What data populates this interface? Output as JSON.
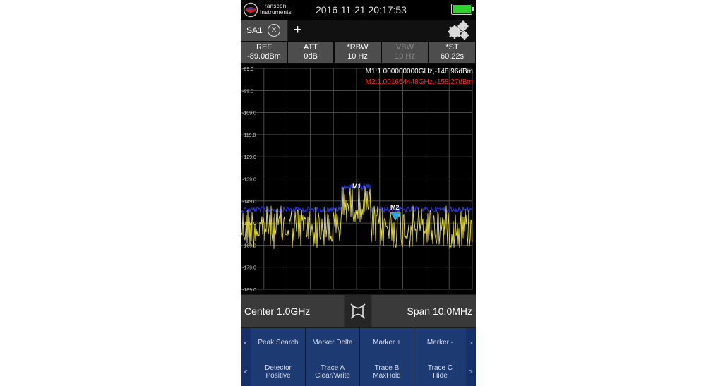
{
  "status_bar": {
    "brand_line1": "Transcon",
    "brand_line2": "Instruments",
    "datetime": "2016-11-21 20:17:53"
  },
  "tabs": {
    "active_label": "SA1",
    "close_glyph": "X",
    "add_glyph": "+"
  },
  "params": [
    {
      "label": "REF",
      "value": "-89.0dBm",
      "enabled": true
    },
    {
      "label": "ATT",
      "value": "0dB",
      "enabled": true
    },
    {
      "label": "*RBW",
      "value": "10 Hz",
      "enabled": true
    },
    {
      "label": "VBW",
      "value": "10 Hz",
      "enabled": false
    },
    {
      "label": "*ST",
      "value": "60.22s",
      "enabled": true
    }
  ],
  "plot": {
    "y_labels": [
      "-89.0",
      "-99.0",
      "-109.0",
      "-119.0",
      "-129.0",
      "-139.0",
      "-149.0",
      "-159.0",
      "-169.0",
      "-179.0",
      "-189.0"
    ],
    "marker1_readout": "M1:1.000000000GHz,-148.96dBm",
    "marker2_readout": "M2:1.001654448GHz,-158.27dBm",
    "marker1_label": "M1",
    "marker2_label": "M2",
    "colors": {
      "trace_a": "#e8e02a",
      "trace_b": "#2833d8",
      "marker1": "#ffffff",
      "marker2": "#ff2a2a",
      "grid": "#5a5a5a"
    }
  },
  "freq_bar": {
    "center": "Center 1.0GHz",
    "span": "Span 10.0MHz",
    "swap_icon": "swap-icon"
  },
  "softkeys_row1": {
    "left_arrow": "<",
    "right_arrow": ">",
    "keys": [
      "Peak Search",
      "Marker Delta",
      "Marker +",
      "Marker -"
    ]
  },
  "softkeys_row2": {
    "left_arrow": "<",
    "right_arrow": ">",
    "keys": [
      {
        "line1": "Detector",
        "line2": "Positive"
      },
      {
        "line1": "Trace A",
        "line2": "Clear/Write"
      },
      {
        "line1": "Trace B",
        "line2": "MaxHold"
      },
      {
        "line1": "Trace C",
        "line2": "Hide"
      }
    ]
  }
}
